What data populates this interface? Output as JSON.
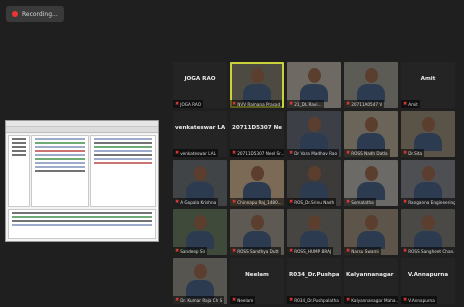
{
  "recording": {
    "label": "Recording..."
  },
  "tiles": [
    {
      "name": "JOGA RAO",
      "label": "JOGA RAO",
      "video": false,
      "bg": "#242424"
    },
    {
      "name": "",
      "label": "NVV Ramana Prasad",
      "video": true,
      "bg": "#4d4a42",
      "active": true
    },
    {
      "name": "",
      "label": "21_DL Ravi...",
      "video": true,
      "bg": "#6e6a63"
    },
    {
      "name": "",
      "label": "20711A0547 V",
      "video": true,
      "bg": "#5d5b56"
    },
    {
      "name": "Amit",
      "label": "Amit",
      "video": false,
      "bg": "#242424"
    },
    {
      "name": "venkateswar LAL",
      "label": "venkateswar LAL",
      "video": false,
      "bg": "#242424"
    },
    {
      "name": "20711D5307 Ne...",
      "label": "20711D5307 Neel Sr...",
      "video": false,
      "bg": "#242424"
    },
    {
      "name": "",
      "label": "Dr Vara Madhav Rao",
      "video": true,
      "bg": "#3c3f45"
    },
    {
      "name": "",
      "label": "ROSS Nadh Datla",
      "video": true,
      "bg": "#6a6558"
    },
    {
      "name": "",
      "label": "Dr.Sita",
      "video": true,
      "bg": "#5a5448"
    },
    {
      "name": "",
      "label": "A Gopala Krishna",
      "video": true,
      "bg": "#404447"
    },
    {
      "name": "",
      "label": "Chinnapu Raj_1480...",
      "video": true,
      "bg": "#7b6a55"
    },
    {
      "name": "",
      "label": "ROS_Dr.Srinu Nadh",
      "video": true,
      "bg": "#3d3b39"
    },
    {
      "name": "",
      "label": "Somalatha",
      "video": true,
      "bg": "#6b6a66"
    },
    {
      "name": "",
      "label": "Ranganna Engineering",
      "video": true,
      "bg": "#4e4f53"
    },
    {
      "name": "",
      "label": "Sandeep Sir",
      "video": true,
      "bg": "#3f4a3a"
    },
    {
      "name": "",
      "label": "ROSS Sandhya Dutt",
      "video": true,
      "bg": "#5e5a53"
    },
    {
      "name": "",
      "label": "ROSS_HUMP BRAJ",
      "video": true,
      "bg": "#474541"
    },
    {
      "name": "",
      "label": "Narsu Swami",
      "video": true,
      "bg": "#5d5549"
    },
    {
      "name": "",
      "label": "ROSS Sangheet Chan...",
      "video": true,
      "bg": "#4a4945"
    },
    {
      "name": "",
      "label": "Dr. Kumar Raja Ch S",
      "video": true,
      "bg": "#565550"
    },
    {
      "name": "Neelam",
      "label": "Neelam",
      "video": false,
      "bg": "#242424"
    },
    {
      "name": "R034_Dr.Pushpa...",
      "label": "R034_Dr.Pushpalatha",
      "video": false,
      "bg": "#242424"
    },
    {
      "name": "Kalyannanagar ...",
      "label": "Kalyannanagar Maha...",
      "video": false,
      "bg": "#242424"
    },
    {
      "name": "V.Annapurna",
      "label": "V.Annapurna",
      "video": false,
      "bg": "#242424"
    }
  ]
}
